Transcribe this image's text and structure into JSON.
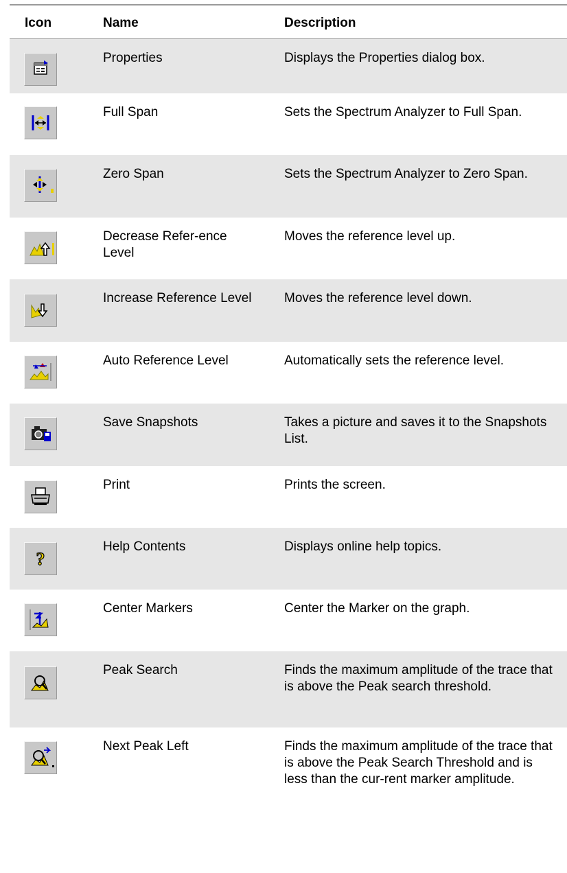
{
  "header": {
    "icon": "Icon",
    "name": "Name",
    "description": "Description"
  },
  "rows": [
    {
      "name": "Properties",
      "description": "Displays the Properties dialog box.",
      "icon": "properties-icon"
    },
    {
      "name": "Full Span",
      "description": "Sets the Spectrum Analyzer to Full Span.",
      "icon": "full-span-icon"
    },
    {
      "name": "Zero Span",
      "description": "Sets the Spectrum Analyzer to Zero Span.",
      "icon": "zero-span-icon"
    },
    {
      "name": "Decrease Refer-ence Level",
      "description": "Moves the reference level up.",
      "icon": "decrease-reference-level-icon"
    },
    {
      "name": "Increase Reference Level",
      "description": "Moves the reference level down.",
      "icon": "increase-reference-level-icon"
    },
    {
      "name": "Auto Reference Level",
      "description": "Automatically sets the reference level.",
      "icon": "auto-reference-level-icon"
    },
    {
      "name": "Save Snapshots",
      "description": "Takes a picture and saves it to the Snapshots List.",
      "icon": "camera-icon"
    },
    {
      "name": "Print",
      "description": "Prints the screen.",
      "icon": "printer-icon"
    },
    {
      "name": "Help Contents",
      "description": "Displays online help topics.",
      "icon": "question-mark-icon"
    },
    {
      "name": "Center Markers",
      "description": "Center the Marker on the graph.",
      "icon": "center-markers-icon"
    },
    {
      "name": "Peak Search",
      "description": "Finds the maximum amplitude of the trace that is above the Peak search threshold.",
      "icon": "peak-search-icon"
    },
    {
      "name": "Next Peak Left",
      "description": "Finds the maximum amplitude of the trace that is above the Peak Search Threshold and is less than the cur-rent marker amplitude.",
      "icon": "next-peak-left-icon"
    }
  ],
  "colors": {
    "row_shade": "#e6e6e6",
    "icon_face": "#c8c8c8",
    "accent_blue": "#0000cc",
    "accent_yellow": "#e8d000"
  }
}
